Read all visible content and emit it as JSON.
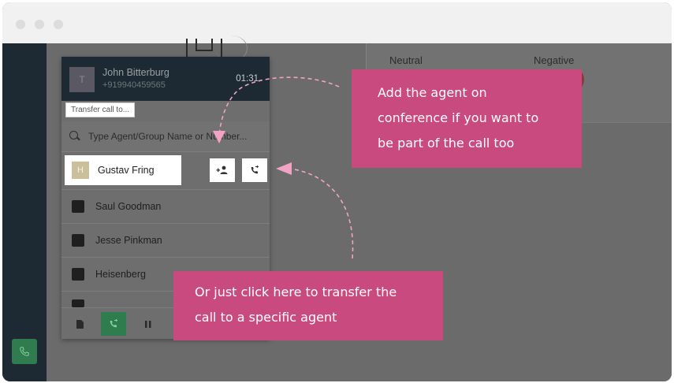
{
  "window": {
    "traffic_lights": [
      "close",
      "minimize",
      "zoom"
    ]
  },
  "sentiment": {
    "labels": [
      "Neutral",
      "Negative"
    ]
  },
  "caller": {
    "avatar_initial": "T",
    "name": "John Bitterburg",
    "phone": "+919940459565",
    "timer": "01:31"
  },
  "transfer": {
    "label": "Transfer call to...",
    "search_placeholder": "Type Agent/Group Name or Number..."
  },
  "agents": {
    "highlighted": {
      "initial": "H",
      "name": "Gustav Fring"
    },
    "actions": [
      {
        "name": "add-to-conference",
        "icon": "person-add-icon"
      },
      {
        "name": "transfer-call",
        "icon": "phone-transfer-icon"
      }
    ],
    "list": [
      {
        "name": "Saul Goodman",
        "icon": "group-icon"
      },
      {
        "name": "Jesse Pinkman",
        "icon": "group-icon"
      },
      {
        "name": "Heisenberg",
        "icon": "group-icon"
      }
    ]
  },
  "footer": {
    "buttons": [
      "notes-icon",
      "transfer-phone-icon",
      "pause-icon"
    ]
  },
  "rail": {
    "call_button_icon": "phone-icon"
  },
  "callouts": {
    "conference": {
      "lines": [
        "Add the agent on",
        "conference if you want to",
        "be part of the call too"
      ]
    },
    "transfer": {
      "lines": [
        "Or just click here to transfer the",
        "call to a specific agent"
      ]
    }
  },
  "colors": {
    "callout": "#c94a7e",
    "dark_navy": "#1d2a33",
    "call_green": "#2f7d4e",
    "arrow": "#f2a3c3"
  }
}
